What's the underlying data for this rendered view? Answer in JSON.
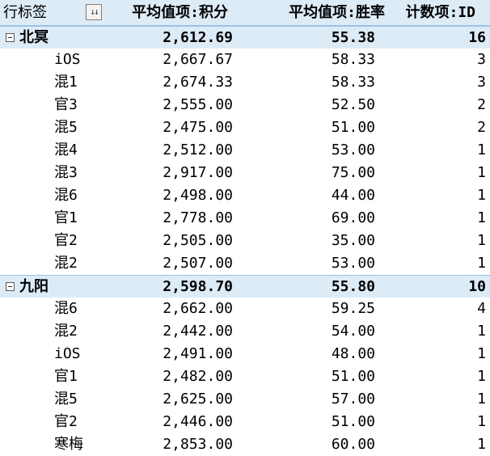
{
  "header": {
    "row_label": "行标签",
    "filter_icon": "sort-filter-icon",
    "filter_glyph": "↓↓",
    "avg_score": "平均值项:积分",
    "avg_rate": "平均值项:胜率",
    "count_id": "计数项:ID"
  },
  "groups": [
    {
      "name": "北冥",
      "avg_score": "2,612.69",
      "avg_rate": "55.38",
      "count": "16",
      "items": [
        {
          "label": "iOS",
          "score": "2,667.67",
          "rate": "58.33",
          "count": "3"
        },
        {
          "label": "混1",
          "score": "2,674.33",
          "rate": "58.33",
          "count": "3"
        },
        {
          "label": "官3",
          "score": "2,555.00",
          "rate": "52.50",
          "count": "2"
        },
        {
          "label": "混5",
          "score": "2,475.00",
          "rate": "51.00",
          "count": "2"
        },
        {
          "label": "混4",
          "score": "2,512.00",
          "rate": "53.00",
          "count": "1"
        },
        {
          "label": "混3",
          "score": "2,917.00",
          "rate": "75.00",
          "count": "1"
        },
        {
          "label": "混6",
          "score": "2,498.00",
          "rate": "44.00",
          "count": "1"
        },
        {
          "label": "官1",
          "score": "2,778.00",
          "rate": "69.00",
          "count": "1"
        },
        {
          "label": "官2",
          "score": "2,505.00",
          "rate": "35.00",
          "count": "1"
        },
        {
          "label": "混2",
          "score": "2,507.00",
          "rate": "53.00",
          "count": "1"
        }
      ]
    },
    {
      "name": "九阳",
      "avg_score": "2,598.70",
      "avg_rate": "55.80",
      "count": "10",
      "items": [
        {
          "label": "混6",
          "score": "2,662.00",
          "rate": "59.25",
          "count": "4"
        },
        {
          "label": "混2",
          "score": "2,442.00",
          "rate": "54.00",
          "count": "1"
        },
        {
          "label": "iOS",
          "score": "2,491.00",
          "rate": "48.00",
          "count": "1"
        },
        {
          "label": "官1",
          "score": "2,482.00",
          "rate": "51.00",
          "count": "1"
        },
        {
          "label": "混5",
          "score": "2,625.00",
          "rate": "57.00",
          "count": "1"
        },
        {
          "label": "官2",
          "score": "2,446.00",
          "rate": "51.00",
          "count": "1"
        },
        {
          "label": "寒梅",
          "score": "2,853.00",
          "rate": "60.00",
          "count": "1"
        }
      ]
    }
  ],
  "colors": {
    "header_fill": "#DDEBF7",
    "header_border": "#9BC2E6",
    "text": "#000000"
  }
}
